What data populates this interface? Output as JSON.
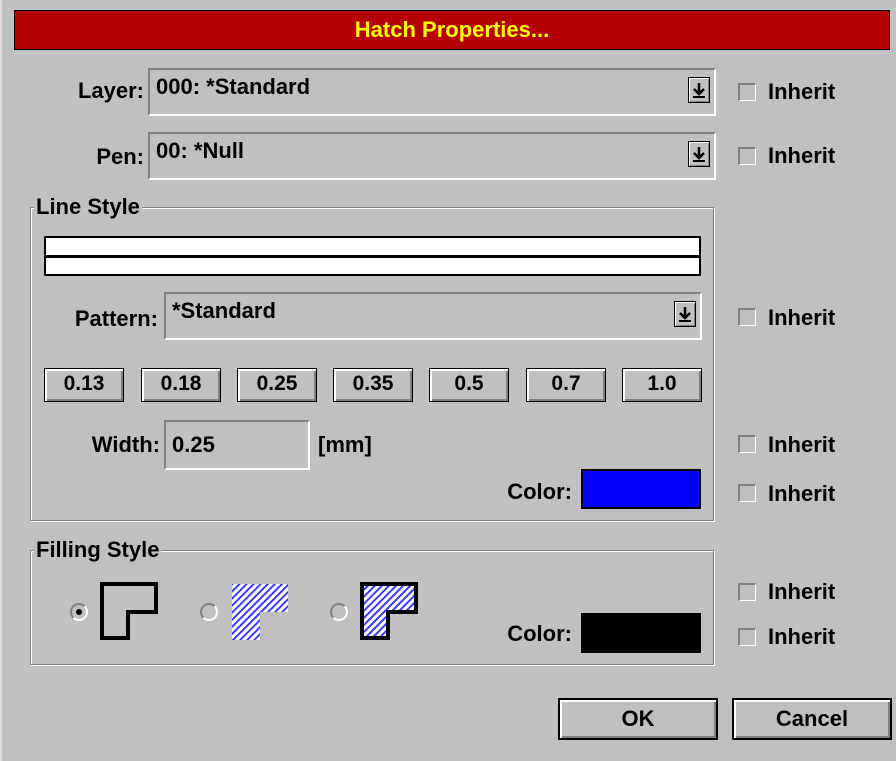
{
  "dialog": {
    "title": "Hatch Properties..."
  },
  "layer": {
    "label": "Layer:",
    "value": "000: *Standard",
    "inherit_label": "Inherit"
  },
  "pen": {
    "label": "Pen:",
    "value": "00: *Null",
    "inherit_label": "Inherit"
  },
  "line_style": {
    "group_title": "Line Style",
    "pattern": {
      "label": "Pattern:",
      "value": "*Standard",
      "inherit_label": "Inherit"
    },
    "width_buttons": [
      {
        "label": "0.13"
      },
      {
        "label": "0.18"
      },
      {
        "label": "0.25"
      },
      {
        "label": "0.35"
      },
      {
        "label": "0.5"
      },
      {
        "label": "0.7"
      },
      {
        "label": "1.0"
      }
    ],
    "width": {
      "label": "Width:",
      "value": "0.25",
      "unit": "[mm]",
      "inherit_label": "Inherit"
    },
    "color": {
      "label": "Color:",
      "value": "#0000ff",
      "inherit_label": "Inherit"
    }
  },
  "filling_style": {
    "group_title": "Filling Style",
    "options": [
      {
        "name": "outline-only",
        "selected": true
      },
      {
        "name": "hatch-only",
        "selected": false
      },
      {
        "name": "outline-and-hatch",
        "selected": false
      }
    ],
    "inherit_label_1": "Inherit",
    "color": {
      "label": "Color:",
      "value": "#000000",
      "inherit_label": "Inherit"
    }
  },
  "buttons": {
    "ok": "OK",
    "cancel": "Cancel"
  },
  "icons": {
    "dropdown": "dropdown-arrow-icon"
  }
}
